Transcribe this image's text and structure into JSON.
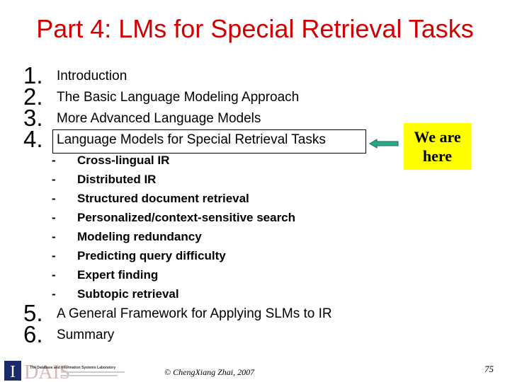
{
  "title": "Part 4: LMs for Special Retrieval Tasks",
  "items": [
    {
      "num": "1.",
      "label": "Introduction"
    },
    {
      "num": "2.",
      "label": "The Basic Language Modeling Approach"
    },
    {
      "num": "3.",
      "label": "More Advanced Language Models"
    },
    {
      "num": "4.",
      "label": "Language Models for Special Retrieval Tasks"
    },
    {
      "num": "5.",
      "label": "A General Framework for Applying SLMs to IR"
    },
    {
      "num": "6.",
      "label": "Summary"
    }
  ],
  "subitems": [
    "Cross-lingual IR",
    "Distributed IR",
    "Structured document retrieval",
    "Personalized/context-sensitive search",
    "Modeling redundancy",
    "Predicting query difficulty",
    "Expert finding",
    "Subtopic retrieval"
  ],
  "dash": "-",
  "callout": {
    "line1": "We are",
    "line2": "here",
    "bg": "#ffff00"
  },
  "footer": {
    "copyright": "© ChengXiang Zhai, 2007",
    "page": "75",
    "logo": "I DAIS The Database and Information Systems Laboratory"
  },
  "colors": {
    "title": "#d00000",
    "arrow": "#2aa88a"
  }
}
